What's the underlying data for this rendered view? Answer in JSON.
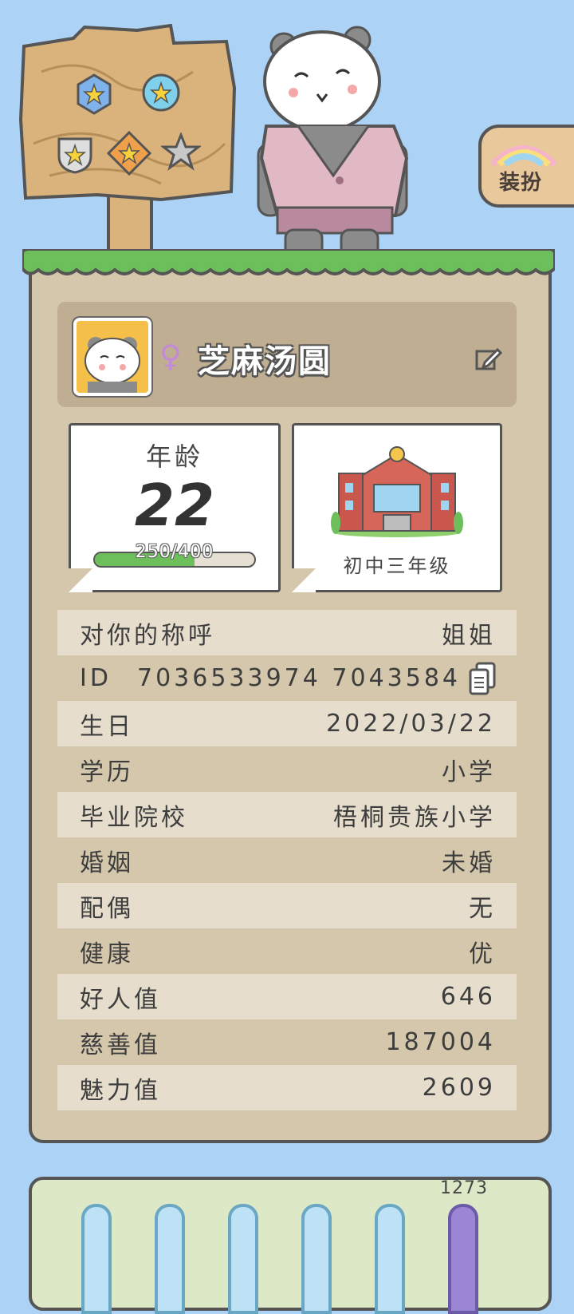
{
  "dress_button": {
    "label": "装扮"
  },
  "profile": {
    "gender_symbol": "♀",
    "nickname": "芝麻汤圆"
  },
  "age_card": {
    "title": "年龄",
    "age": "22",
    "xp_text": "250/400",
    "xp_progress": 0.625
  },
  "school_card": {
    "grade": "初中三年级"
  },
  "info_rows": [
    {
      "label": "对你的称呼",
      "value": "姐姐"
    },
    {
      "label": "ID",
      "value": "7036533974 7043584"
    },
    {
      "label": "生日",
      "value": "2022/03/22"
    },
    {
      "label": "学历",
      "value": "小学"
    },
    {
      "label": "毕业院校",
      "value": "梧桐贵族小学"
    },
    {
      "label": "婚姻",
      "value": "未婚"
    },
    {
      "label": "配偶",
      "value": "无"
    },
    {
      "label": "健康",
      "value": "优"
    },
    {
      "label": "好人值",
      "value": "646"
    },
    {
      "label": "慈善值",
      "value": "187004"
    },
    {
      "label": "魅力值",
      "value": "2609"
    }
  ],
  "bottom_panel": {
    "active_value": "1273"
  },
  "colors": {
    "background": "#acd2f5",
    "panel": "#d4c7ab",
    "grass": "#6cbf5a",
    "accent_purple": "#9b86d6"
  }
}
